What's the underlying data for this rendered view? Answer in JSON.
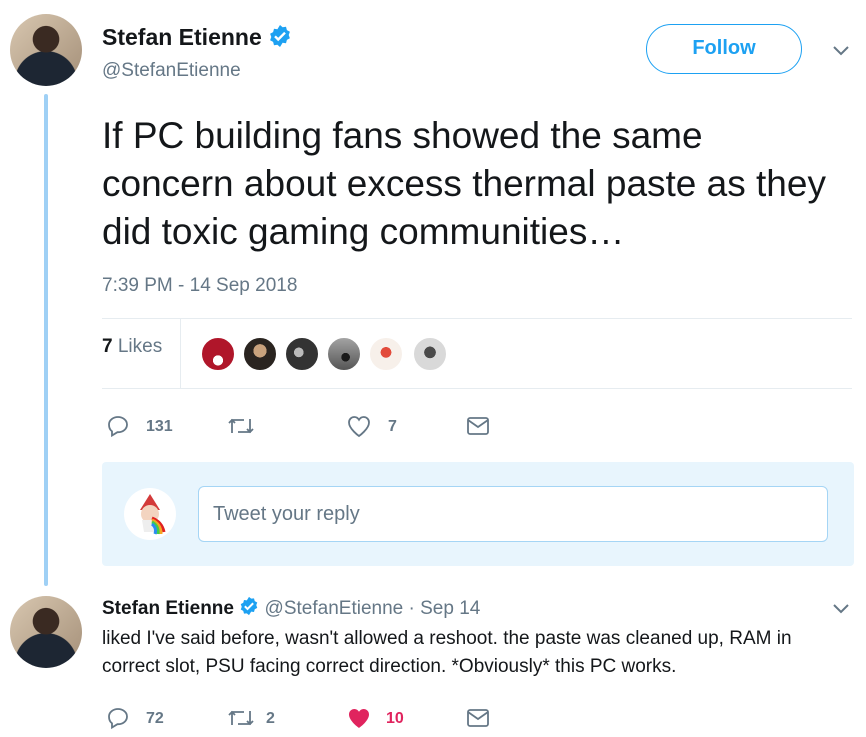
{
  "main_tweet": {
    "author_name": "Stefan Etienne",
    "handle": "@StefanEtienne",
    "follow_label": "Follow",
    "text": "If PC building fans showed the same concern about excess thermal paste as they did toxic gaming communities…",
    "timestamp": "7:39 PM - 14 Sep 2018",
    "likes_count": "7",
    "likes_label": "Likes",
    "reply_count": "131",
    "like_count": "7"
  },
  "reply_box": {
    "placeholder": "Tweet your reply"
  },
  "reply_tweet": {
    "author_name": "Stefan Etienne",
    "handle": "@StefanEtienne",
    "dot": "·",
    "date": "Sep 14",
    "text": "liked I've said before, wasn't allowed a reshoot. the paste was cleaned up, RAM in correct slot, PSU facing correct direction. *Obviously* this PC works.",
    "reply_count": "72",
    "retweet_count": "2",
    "like_count": "10"
  },
  "colors": {
    "accent": "#1da1f2",
    "liked": "#e0245e",
    "muted": "#657786"
  }
}
